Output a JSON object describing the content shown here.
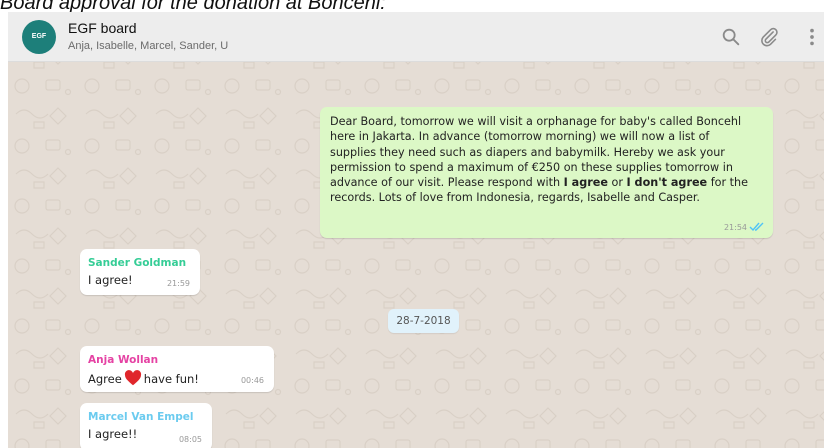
{
  "caption": "Board approval for the donation at Boncehl:",
  "header": {
    "avatar_text": "EGF",
    "title": "EGF board",
    "members": "Anja, Isabelle, Marcel, Sander, U"
  },
  "outgoing": {
    "line1": "Dear Board, tomorrow we will visit a orphanage for baby's called Boncehl",
    "line2": "here in Jakarta. In advance (tomorrow morning) we will now a list of",
    "line3": "supplies they need such as diapers and babymilk. Hereby we ask your",
    "line4": "permission to spend a maximum of €250 on these supplies tomorrow in",
    "line5_pre": "advance of our visit. Please respond with ",
    "line5_bold1": "I agree",
    "line5_mid": " or ",
    "line5_bold2": "I don't agree",
    "line5_post": " for the",
    "line6": "records. Lots of love from Indonesia, regards, Isabelle and Casper.",
    "time": "21:54",
    "status": "read"
  },
  "date_separator": "28-7-2018",
  "incoming": [
    {
      "sender": "Sander Goldman",
      "sender_color": "#35cd96",
      "text": "I agree!",
      "time": "21:59"
    },
    {
      "sender": "Anja Wollan",
      "sender_color": "#e542a3",
      "text_before": "Agree",
      "text_after": "have fun!",
      "time": "00:46"
    },
    {
      "sender": "Marcel Van Empel",
      "sender_color": "#6bcbef",
      "text": "I agree!!",
      "time": "08:05"
    }
  ],
  "colors": {
    "chat_background": "#e5ddd5",
    "outgoing_bubble": "#dcf8c6",
    "incoming_bubble": "#ffffff",
    "read_ticks": "#4fc3f7",
    "date_pill": "#e1f2fb"
  },
  "icons": [
    "search-icon",
    "attach-icon",
    "more-vertical-icon",
    "double-check-icon",
    "heart-icon"
  ]
}
